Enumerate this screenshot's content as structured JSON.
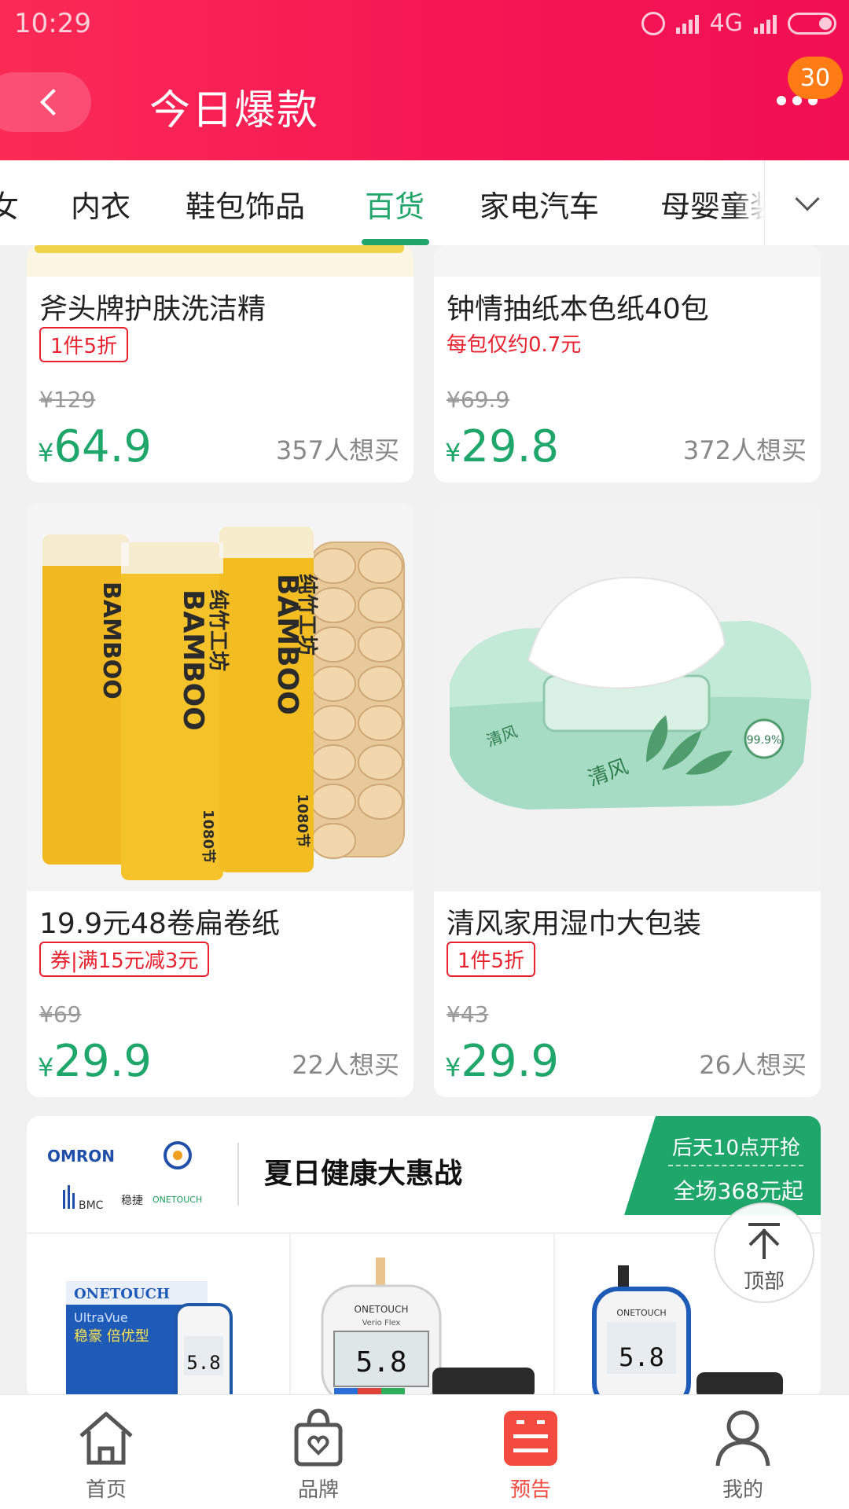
{
  "status_bar": {
    "time": "10:29",
    "network": "4G"
  },
  "header": {
    "title": "今日爆款",
    "badge_count": "30"
  },
  "tabs": {
    "items": [
      "女",
      "内衣",
      "鞋包饰品",
      "百货",
      "家电汽车",
      "母婴童装"
    ],
    "active": "百货"
  },
  "products": [
    {
      "name": "斧头牌护肤洗洁精",
      "tag": "1件5折",
      "orig_price": "¥129",
      "currency": "¥",
      "price": "64.9",
      "want": "357人想买"
    },
    {
      "name": "钟情抽纸本色纸40包",
      "tag": "每包仅约0.7元",
      "orig_price": "¥69.9",
      "currency": "¥",
      "price": "29.8",
      "want": "372人想买"
    },
    {
      "name": "19.9元48卷扁卷纸",
      "tag": "券|满15元减3元",
      "orig_price": "¥69",
      "currency": "¥",
      "price": "29.9",
      "want": "22人想买"
    },
    {
      "name": "清风家用湿巾大包装",
      "tag": "1件5折",
      "orig_price": "¥43",
      "currency": "¥",
      "price": "29.9",
      "want": "26人想买"
    }
  ],
  "product_images": {
    "bamboo_brand": "BAMBOO",
    "bamboo_brand_cn": "纯竹工坊",
    "bamboo_count": "1080节",
    "wipes_brand": "清风",
    "wipes_badge": "99.9%"
  },
  "promo": {
    "title": "夏日健康大惠战",
    "corner_line1": "后天10点开抢",
    "corner_line2": "全场368元起",
    "logos": [
      "OMRON",
      "BMC",
      "稳捷",
      "ONETOUCH"
    ],
    "items": [
      {
        "brand": "ONETOUCH",
        "sub": "UltraVue",
        "label": "稳豪 倍优型",
        "reading": "5.8"
      },
      {
        "brand": "ONETOUCH",
        "sub": "Verio Flex",
        "label": "",
        "reading": "5.8"
      },
      {
        "brand": "ONETOUCH",
        "sub": "",
        "label": "",
        "reading": "5.8"
      }
    ]
  },
  "to_top_label": "顶部",
  "bottom_nav": [
    {
      "label": "首页",
      "icon": "home-icon"
    },
    {
      "label": "品牌",
      "icon": "brand-bag-icon"
    },
    {
      "label": "预告",
      "icon": "preview-icon"
    },
    {
      "label": "我的",
      "icon": "profile-icon"
    }
  ],
  "bottom_nav_active": "预告",
  "colors": {
    "header": "#f5164f",
    "accent_green": "#1fa66a",
    "tag_red": "#e8232f",
    "nav_active": "#f34b40",
    "badge": "#ff7b14"
  }
}
